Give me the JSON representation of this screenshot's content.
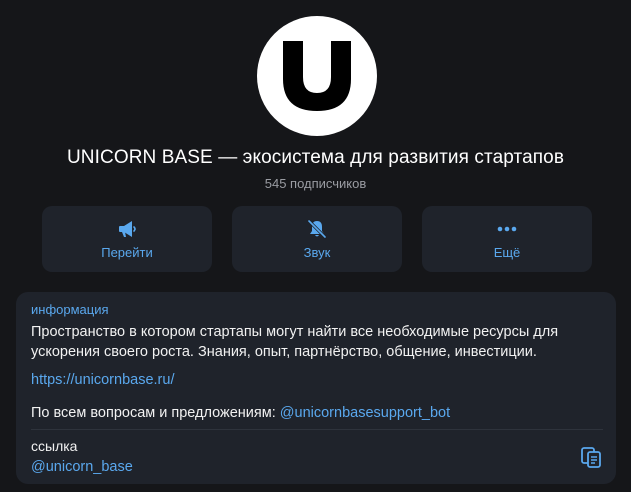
{
  "channel": {
    "avatar_letter": "U",
    "title": "UNICORN BASE — экосистема для развития стартапов",
    "subscribers": "545 подписчиков"
  },
  "actions": [
    {
      "label": "Перейти",
      "icon": "megaphone-icon"
    },
    {
      "label": "Звук",
      "icon": "bell-muted-icon"
    },
    {
      "label": "Ещё",
      "icon": "more-dots-icon"
    }
  ],
  "info": {
    "label": "информация",
    "description": "Пространство в котором стартапы могут найти все необходимые ресурсы для ускорения своего роста. Знания, опыт, партнёрство, общение, инвестиции.",
    "website": "https://unicornbase.ru/",
    "contact_prefix": "По всем вопросам и предложениям: ",
    "contact_bot": "@unicornbasesupport_bot",
    "link_label": "ссылка",
    "link_value": "@unicorn_base"
  },
  "colors": {
    "background": "#151619",
    "card": "#1f232b",
    "accent": "#5aa8ee",
    "muted": "#9a9ca2"
  }
}
